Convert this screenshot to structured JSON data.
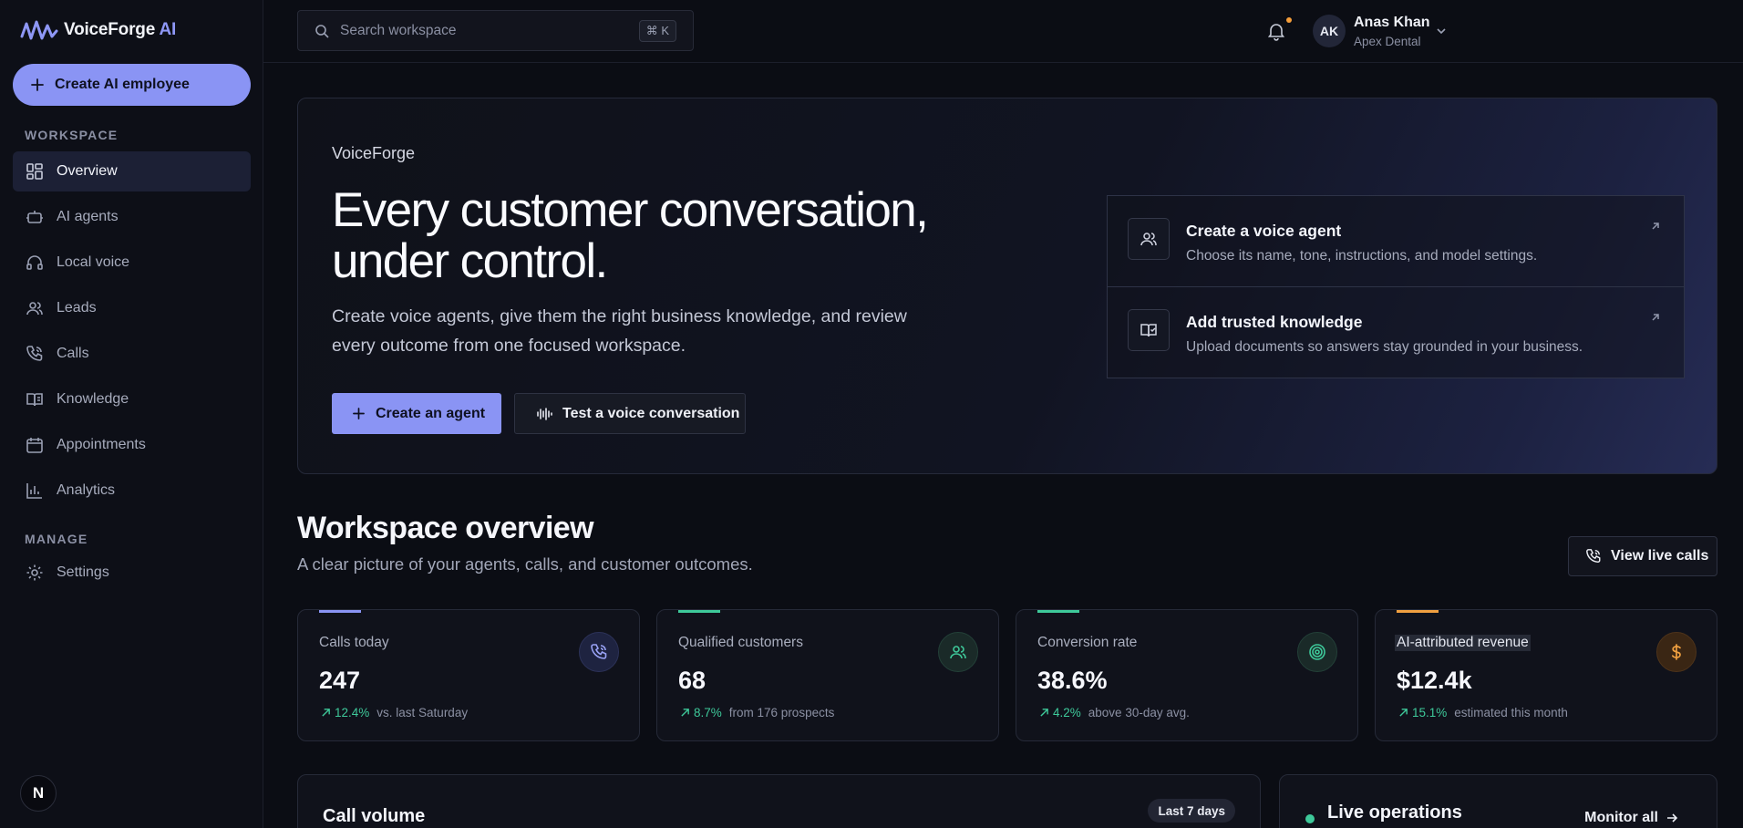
{
  "brand": {
    "name": "VoiceForge",
    "suffix": "AI",
    "accent": "#8a94f4"
  },
  "sidebar": {
    "create_label": "Create AI employee",
    "workspace_title": "WORKSPACE",
    "manage_title": "MANAGE",
    "items": [
      {
        "label": "Overview",
        "icon": "grid-icon",
        "active": true
      },
      {
        "label": "AI agents",
        "icon": "bot-icon"
      },
      {
        "label": "Local voice",
        "icon": "headphones-icon"
      },
      {
        "label": "Leads",
        "icon": "users-icon"
      },
      {
        "label": "Calls",
        "icon": "phone-icon"
      },
      {
        "label": "Knowledge",
        "icon": "book-icon"
      },
      {
        "label": "Appointments",
        "icon": "calendar-icon"
      },
      {
        "label": "Analytics",
        "icon": "bar-chart-icon"
      }
    ],
    "manage_items": [
      {
        "label": "Settings",
        "icon": "gear-icon"
      }
    ],
    "footer_badge": "N"
  },
  "topbar": {
    "search_placeholder": "Search workspace",
    "search_shortcut": "⌘ K",
    "user": {
      "initials": "AK",
      "name": "Anas Khan",
      "org": "Apex Dental"
    }
  },
  "hero": {
    "eyebrow": "VoiceForge",
    "title": "Every customer conversation, under control.",
    "subtitle": "Create voice agents, give them the right business knowledge, and review every outcome from one focused workspace.",
    "primary_label": "Create an agent",
    "secondary_label": "Test a voice conversation",
    "actions": [
      {
        "title": "Create a voice agent",
        "desc": "Choose its name, tone, instructions, and model settings.",
        "icon": "users-icon"
      },
      {
        "title": "Add trusted knowledge",
        "desc": "Upload documents so answers stay grounded in your business.",
        "icon": "book-check-icon"
      }
    ]
  },
  "overview": {
    "title": "Workspace overview",
    "subtitle": "A clear picture of your agents, calls, and customer outcomes.",
    "live_calls_label": "View live calls",
    "stats": [
      {
        "label": "Calls today",
        "value": "247",
        "pct": "12.4%",
        "note": "vs. last Saturday",
        "color": "#8a94f4",
        "icon": "phone-icon"
      },
      {
        "label": "Qualified customers",
        "value": "68",
        "pct": "8.7%",
        "note": "from 176 prospects",
        "color": "#3ec99a",
        "icon": "users-icon"
      },
      {
        "label": "Conversion rate",
        "value": "38.6%",
        "pct": "4.2%",
        "note": "above 30-day avg.",
        "color": "#3ec99a",
        "icon": "target-icon"
      },
      {
        "label": "AI-attributed revenue",
        "value": "$12.4k",
        "pct": "15.1%",
        "note": "estimated this month",
        "color": "#f0a040",
        "icon": "dollar-icon"
      }
    ]
  },
  "panels": {
    "call_volume": {
      "title": "Call volume",
      "range": "Last 7 days"
    },
    "live_ops": {
      "title": "Live operations",
      "monitor_label": "Monitor all"
    }
  }
}
